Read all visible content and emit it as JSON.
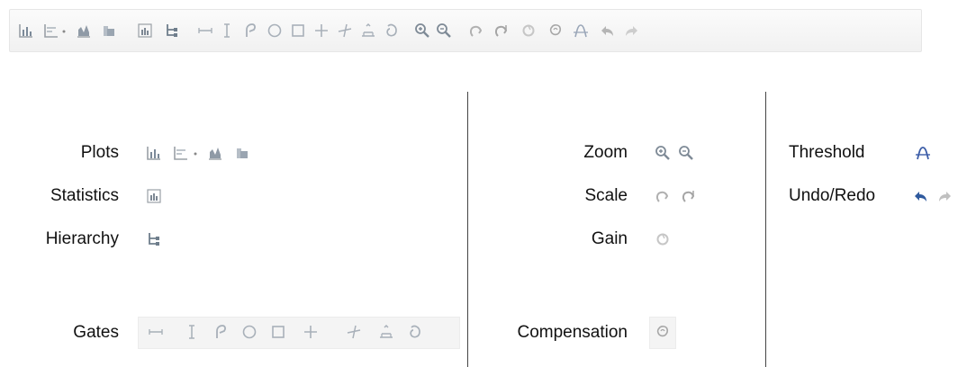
{
  "toolbar": {
    "icons": [
      "bar-plot-icon",
      "line-plot-icon",
      "dropdown-dot-icon",
      "histogram-icon",
      "overlay-plot-icon",
      "statistics-icon",
      "hierarchy-icon",
      "horizontal-gate-icon",
      "vertical-gate-icon",
      "polygon-gate-icon",
      "ellipse-gate-icon",
      "rectangle-gate-icon",
      "quadrant-gate-icon",
      "skewed-quadrant-gate-icon",
      "range-gate-icon",
      "lasso-gate-icon",
      "zoom-in-icon",
      "zoom-out-icon",
      "scale-icon",
      "scale-alt-icon",
      "gain-icon",
      "compensation-icon",
      "threshold-icon",
      "undo-icon",
      "redo-icon"
    ]
  },
  "legend": {
    "plots": "Plots",
    "statistics": "Statistics",
    "hierarchy": "Hierarchy",
    "gates": "Gates",
    "zoom": "Zoom",
    "scale": "Scale",
    "gain": "Gain",
    "compensation": "Compensation",
    "threshold": "Threshold",
    "undo_redo": "Undo/Redo"
  },
  "colors": {
    "icon_gray": "#b8b8b8",
    "threshold_blue": "#3c5da8",
    "undo_blue": "#2f5a9e",
    "redo_gray": "#c0c0c0",
    "toolbar_bg": "#f4f4f4"
  }
}
